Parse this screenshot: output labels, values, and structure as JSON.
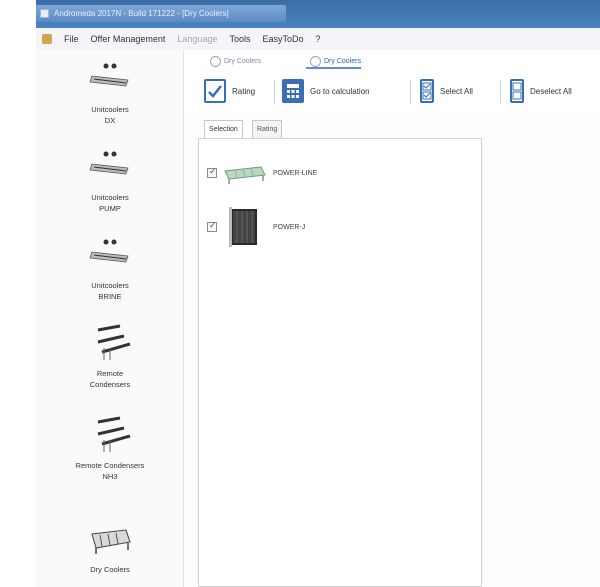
{
  "window": {
    "title": "Andromeda 2017N - Build 171222 - [Dry Coolers]"
  },
  "menubar": {
    "items": [
      {
        "label": "File",
        "enabled": true
      },
      {
        "label": "Offer Management",
        "enabled": true
      },
      {
        "label": "Language",
        "enabled": false
      },
      {
        "label": "Tools",
        "enabled": true
      },
      {
        "label": "EasyToDo",
        "enabled": true
      },
      {
        "label": "?",
        "enabled": true
      }
    ]
  },
  "sidebar": {
    "items": [
      {
        "label": "Unitcoolers\nDX",
        "icon": "unitcooler-icon"
      },
      {
        "label": "Unitcoolers\nPUMP",
        "icon": "unitcooler-icon"
      },
      {
        "label": "Unitcoolers\nBRINE",
        "icon": "unitcooler-icon"
      },
      {
        "label": "Remote\nCondensers",
        "icon": "condenser-icon"
      },
      {
        "label": "Remote Condensers\nNH3",
        "icon": "condenser-icon"
      },
      {
        "label": "Dry Coolers",
        "icon": "dry-cooler-icon"
      }
    ]
  },
  "doc_tabs": [
    {
      "label": "Dry Coolers",
      "active": false
    },
    {
      "label": "Dry Coolers",
      "active": true
    }
  ],
  "toolbar": {
    "rating": "Rating",
    "go_to_calculation": "Go to calculation",
    "select_all": "Select All",
    "deselect_all": "Deselect All"
  },
  "inner_tabs": [
    {
      "label": "Selection",
      "active": true
    },
    {
      "label": "Rating",
      "active": false
    }
  ],
  "products": [
    {
      "label": "POWER-LINE",
      "checked": true
    },
    {
      "label": "POWER-J",
      "checked": true
    }
  ],
  "colors": {
    "titlebar": "#3a6ea5",
    "accent": "#3a6fb8"
  }
}
